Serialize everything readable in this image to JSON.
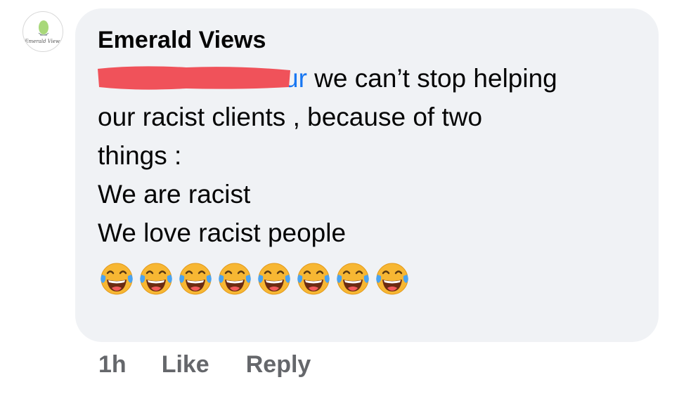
{
  "comment": {
    "author": "Emerald Views",
    "mention_visible_tail": "ur",
    "text_after_mention": " we can’t stop helping",
    "lines": [
      "our racist clients , because of two",
      "things :",
      "We are racist",
      "We love racist people"
    ],
    "emoji_count": 8,
    "emoji_icon": "face-with-tears-of-joy-icon"
  },
  "avatar": {
    "logo_text": "Emerald Views"
  },
  "actions": {
    "timestamp": "1h",
    "like_label": "Like",
    "reply_label": "Reply"
  },
  "colors": {
    "bubble": "#f0f2f5",
    "mention": "#1877f2",
    "redaction": "#f0525a",
    "meta_text": "#65676b"
  }
}
